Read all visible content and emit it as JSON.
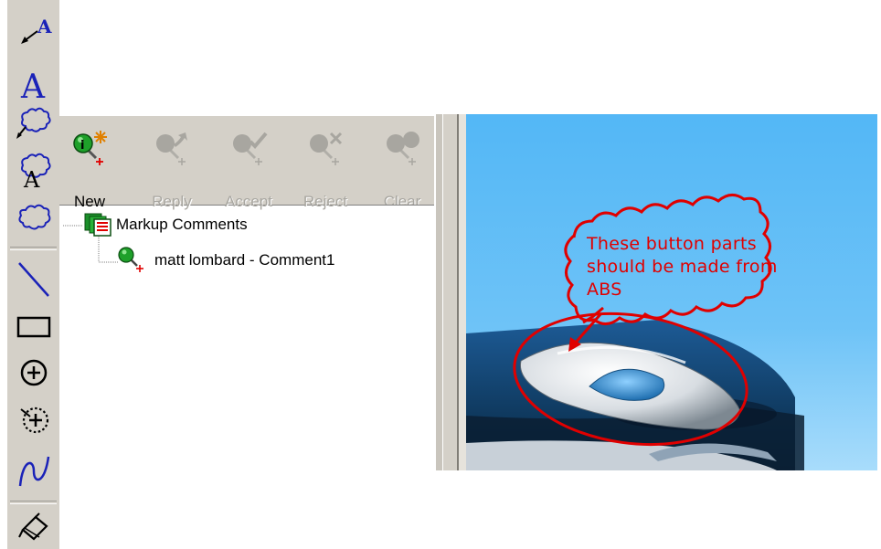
{
  "left_toolbar": {
    "tools": [
      {
        "name": "leader-note-icon"
      },
      {
        "name": "text-note-icon"
      },
      {
        "name": "cloud-leader-icon"
      },
      {
        "name": "cloud-text-icon"
      },
      {
        "name": "cloud-icon"
      },
      {
        "name": "line-icon"
      },
      {
        "name": "rectangle-icon"
      },
      {
        "name": "circle-icon"
      },
      {
        "name": "circle-dotted-icon"
      },
      {
        "name": "spline-icon"
      },
      {
        "name": "erase-icon"
      }
    ]
  },
  "panel": {
    "buttons": [
      {
        "label": "New",
        "enabled": true
      },
      {
        "label": "Reply",
        "enabled": false
      },
      {
        "label": "Accept",
        "enabled": false
      },
      {
        "label": "Reject",
        "enabled": false
      },
      {
        "label": "Clear",
        "enabled": false
      }
    ],
    "tree": {
      "root_label": "Markup Comments",
      "children": [
        {
          "label": "matt lombard - Comment1"
        }
      ]
    }
  },
  "viewport": {
    "callout_lines": [
      "These button parts",
      "should be made from",
      "ABS"
    ]
  },
  "colors": {
    "toolbar_bg": "#d4d0c8",
    "sky_top": "#53b7f6",
    "markup_red": "#e00000",
    "icon_blue": "#1a22b8"
  }
}
